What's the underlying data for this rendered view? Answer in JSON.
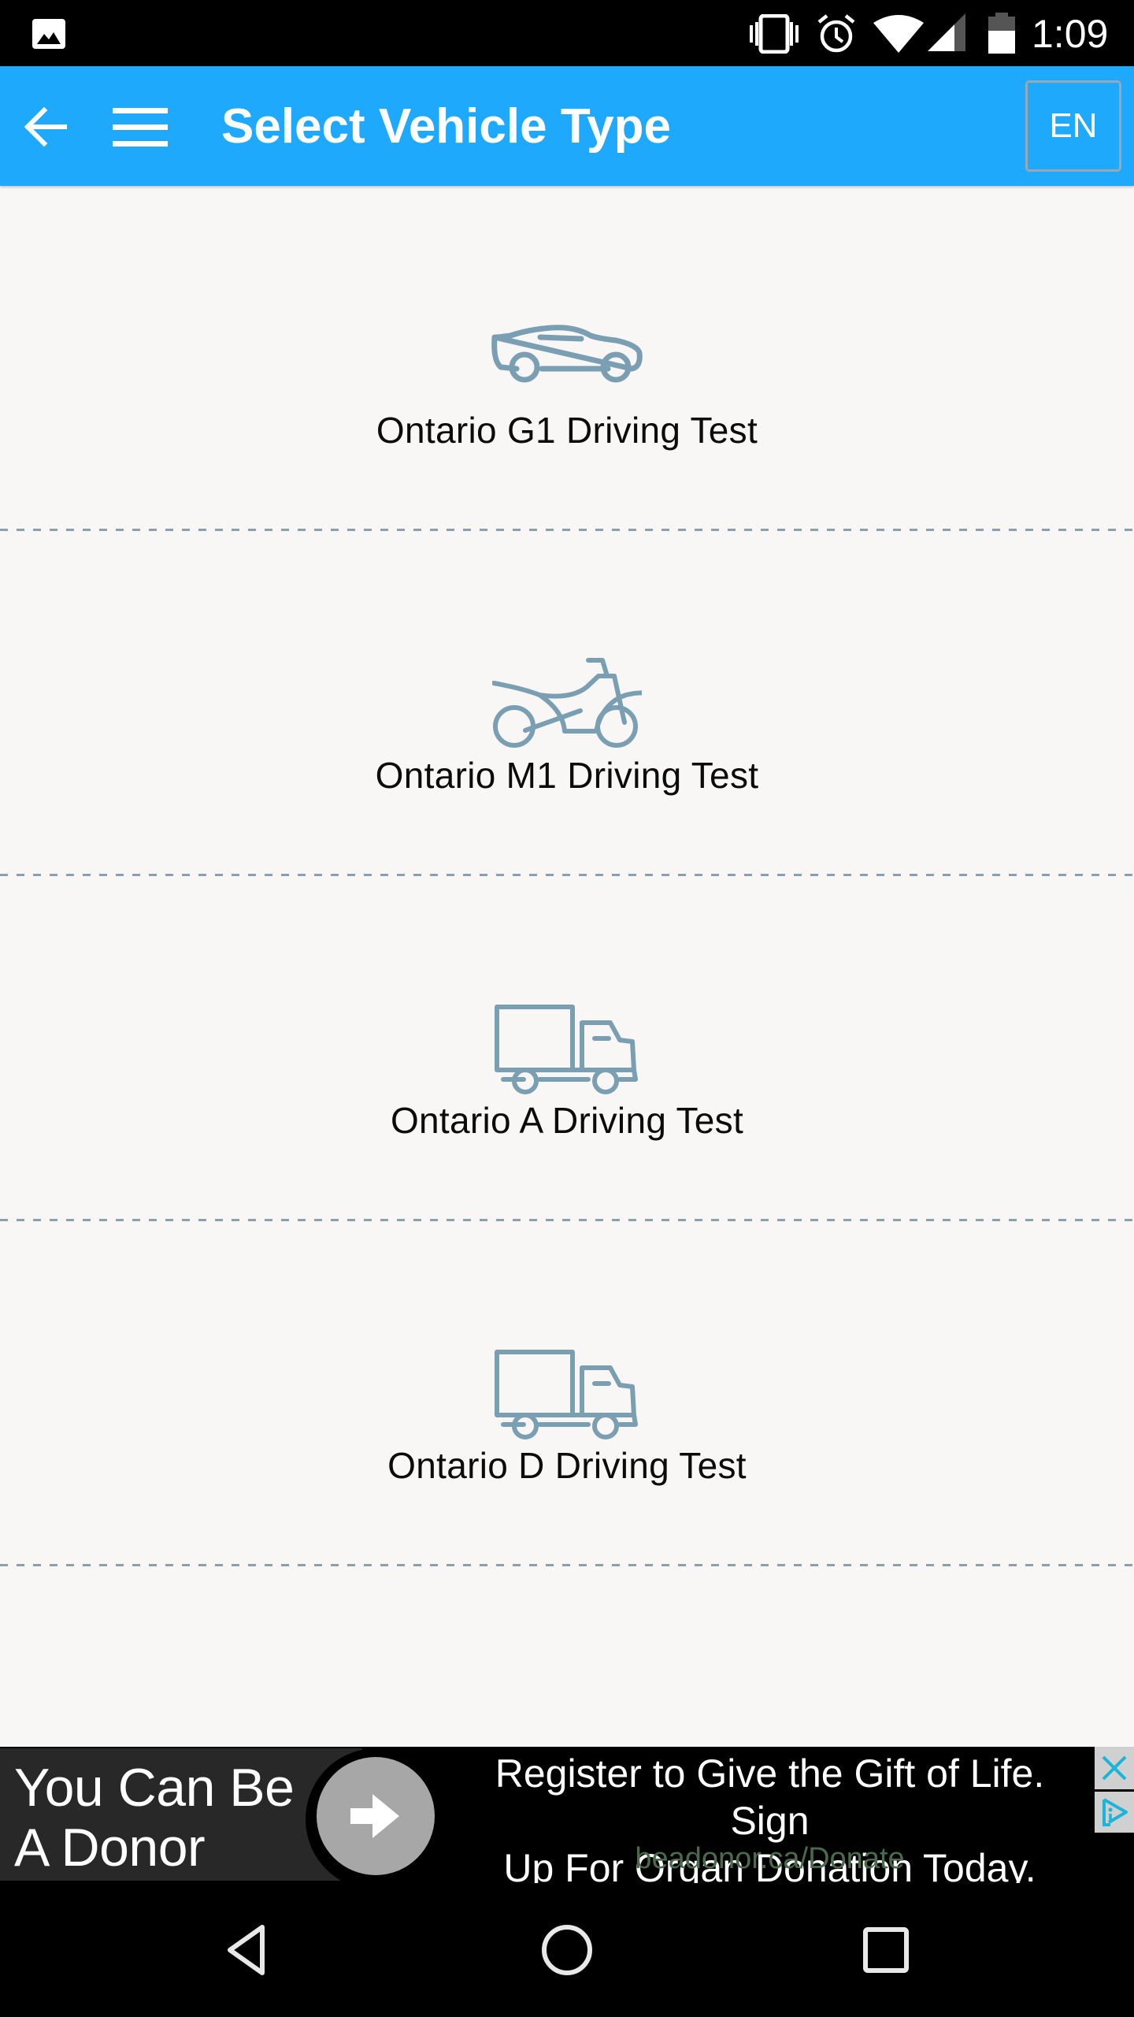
{
  "status_bar": {
    "time": "1:09",
    "icons": [
      "gallery-notification-icon",
      "vibrate-icon",
      "alarm-icon",
      "wifi-icon",
      "cell-signal-icon",
      "battery-icon"
    ]
  },
  "app_bar": {
    "title": "Select Vehicle Type",
    "back_icon": "arrow-left-icon",
    "menu_icon": "hamburger-menu-icon",
    "language_button": "EN",
    "color": "#1EA9FC"
  },
  "vehicle_list": {
    "items": [
      {
        "label": "Ontario G1 Driving Test",
        "icon": "car-icon"
      },
      {
        "label": "Ontario M1 Driving Test",
        "icon": "motorcycle-icon"
      },
      {
        "label": "Ontario A Driving Test",
        "icon": "truck-icon"
      },
      {
        "label": "Ontario D Driving Test",
        "icon": "truck-icon"
      }
    ],
    "icon_color": "#7A9FB2",
    "separator_color": "#8AA0AE"
  },
  "ad_banner": {
    "headline_line1": "You Can Be",
    "headline_line2": "A Donor",
    "body_line1": "Register to Give the Gift of Life. Sign",
    "body_line2": "Up For Organ Donation Today.",
    "url": "beadonor.ca/Donate",
    "go_icon": "arrow-right-icon",
    "close_icon": "close-icon",
    "adchoices_icon": "adchoices-icon",
    "accent_color": "#1BB5D8"
  },
  "nav_bar": {
    "back": "nav-back-icon",
    "home": "nav-home-icon",
    "recents": "nav-recents-icon"
  }
}
